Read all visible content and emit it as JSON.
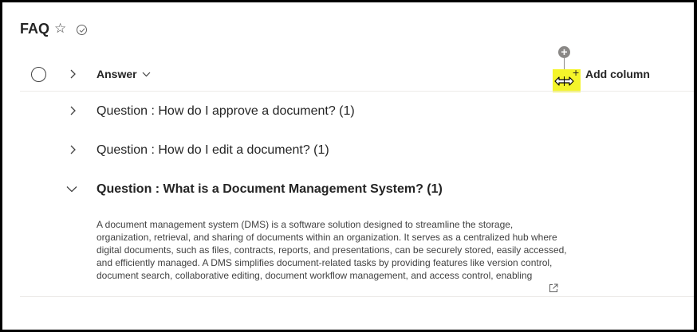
{
  "page": {
    "title": "FAQ"
  },
  "header": {
    "column_answer": "Answer",
    "add_column": "Add column"
  },
  "groups": [
    {
      "label": "Question : How do I approve a document? (1)",
      "expanded": false
    },
    {
      "label": "Question : How do I edit a document? (1)",
      "expanded": false
    },
    {
      "label": "Question : What is a Document Management System? (1)",
      "expanded": true
    }
  ],
  "expanded_item": {
    "answer": "A document management system (DMS) is a software solution designed to streamline the storage, organization, retrieval, and sharing of documents within an organization. It serves as a centralized hub where digital documents, such as files, contracts, reports, and presentations, can be securely stored, easily accessed, and efficiently managed. A DMS simplifies document-related tasks by providing features like version control, document search, collaborative editing, document workflow management, and access control, enabling"
  },
  "icons": {
    "favorite": "star-icon",
    "status": "check-circle-icon",
    "select_all": "radio-circle-icon",
    "expand": "chevron-right-icon",
    "collapse": "chevron-down-icon",
    "add": "plus-circle-icon",
    "resize": "resize-horizontal-icon",
    "open": "open-in-new-icon"
  },
  "colors": {
    "highlight": "#f4f42a",
    "text": "#242424"
  }
}
